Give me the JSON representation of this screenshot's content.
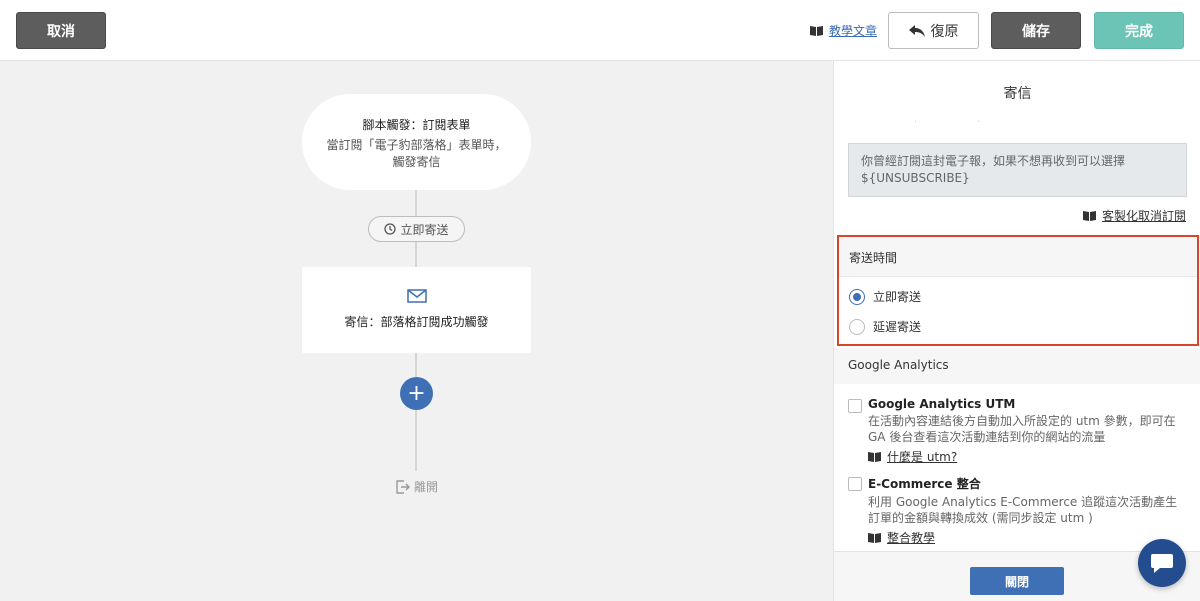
{
  "header": {
    "cancel_label": "取消",
    "tutorial_label": "教學文章",
    "undo_label": "復原",
    "save_label": "儲存",
    "done_label": "完成"
  },
  "flow": {
    "trigger_title": "腳本觸發：訂閱表單",
    "trigger_desc_line1": "當訂閱「電子豹部落格」表單時，",
    "trigger_desc_line2": "觸發寄信",
    "delay_pill": "立即寄送",
    "mail_label": "寄信：部落格訂閱成功觸發",
    "plus_label": "+",
    "exit_label": "離開"
  },
  "panel": {
    "title": "寄信",
    "unsubscribe_text": "你曾經訂閱這封電子報，如果不想再收到可以選擇 ${UNSUBSCRIBE}",
    "custom_unsub_label": "客製化取消訂閱",
    "send_time": {
      "heading": "寄送時間",
      "option_now": "立即寄送",
      "option_delay": "延遲寄送",
      "selected": "立即寄送"
    },
    "ga": {
      "heading": "Google Analytics",
      "utm_title": "Google Analytics UTM",
      "utm_desc": "在活動內容連結後方自動加入所設定的 utm 參數，即可在 GA 後台查看這次活動連結到你的網站的流量",
      "utm_link": "什麼是 utm?",
      "ecom_title": "E-Commerce 整合",
      "ecom_desc": "利用 Google Analytics E-Commerce 追蹤這次活動產生訂單的金額與轉換成效 (需同步設定 utm )",
      "ecom_link": "整合教學"
    },
    "close_label": "關閉"
  },
  "colors": {
    "primary": "#3f6fb5",
    "done": "#6cc4b6",
    "highlight": "#d9442b",
    "dark_button": "#5d5d5d"
  }
}
